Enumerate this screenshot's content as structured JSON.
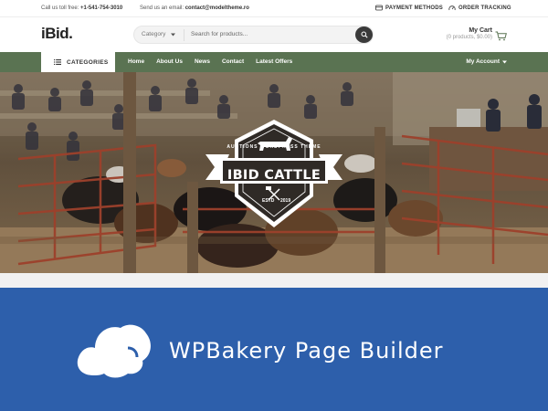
{
  "topbar": {
    "call_label": "Call us toll free:",
    "phone": "+1-541-754-3010",
    "email_label": "Send us an email:",
    "email": "contact@modeltheme.ro",
    "payment_methods": "PAYMENT METHODS",
    "order_tracking": "ORDER TRACKING"
  },
  "header": {
    "logo": "iBid",
    "logo_dot": ".",
    "search": {
      "category_label": "Category",
      "placeholder": "Search for products..."
    },
    "cart": {
      "title": "My Cart",
      "summary": "(0 products, $0.00)"
    }
  },
  "nav": {
    "categories_label": "CATEGORIES",
    "items": [
      {
        "label": "Home"
      },
      {
        "label": "About Us"
      },
      {
        "label": "News"
      },
      {
        "label": "Contact"
      },
      {
        "label": "Latest Offers"
      }
    ],
    "account_label": "My Account"
  },
  "hero": {
    "badge_arc": "AUCTIONS WORDPRESS THEME",
    "badge_title": "IBID CATTLE",
    "badge_est": "ESTD",
    "badge_year": "2019"
  },
  "plugin_banner": {
    "text": "WPBakery Page Builder"
  },
  "colors": {
    "nav_green": "#5a7352",
    "banner_blue": "#2d5fab",
    "search_button": "#3a3a3a"
  }
}
